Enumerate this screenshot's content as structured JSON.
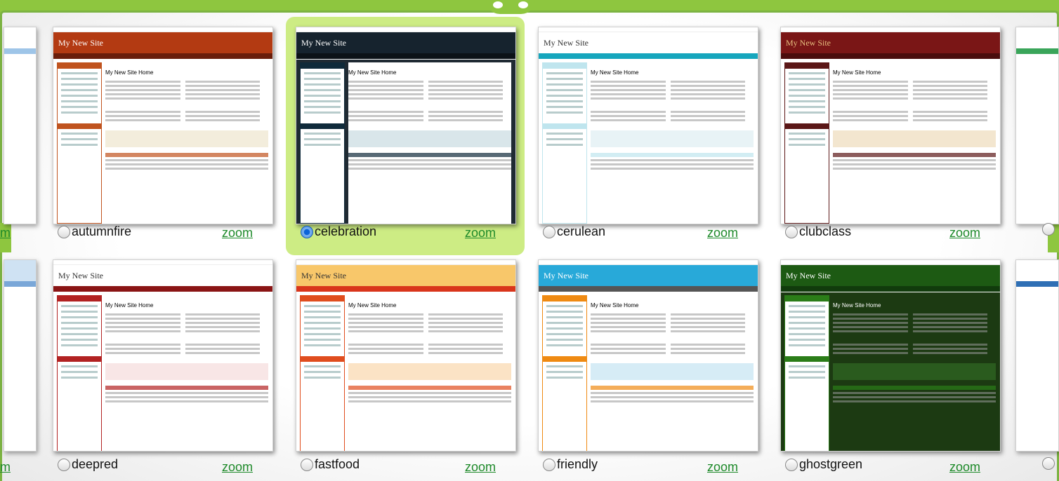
{
  "themes": [
    {
      "name": "autumnfire",
      "zoom": "zoom",
      "selected": false,
      "head": "#b33a12",
      "nav": "#6a1d0a",
      "accent": "#c0531e",
      "band": "#f3eddc",
      "site_color": "#ffffff"
    },
    {
      "name": "celebration",
      "zoom": "zoom",
      "selected": true,
      "head": "#16232e",
      "nav": "#0c1217",
      "accent": "#0f2a3a",
      "band": "#d9e6ea",
      "site_color": "#ffffff"
    },
    {
      "name": "cerulean",
      "zoom": "zoom",
      "selected": false,
      "head": "#ffffff",
      "nav": "#16a6bd",
      "accent": "#bfe5ee",
      "band": "#e8f3f6",
      "site_color": "#333333"
    },
    {
      "name": "clubclass",
      "zoom": "zoom",
      "selected": false,
      "head": "#7a1616",
      "nav": "#4a0c0c",
      "accent": "#5b1717",
      "band": "#f3e6cf",
      "site_color": "#e8c080"
    },
    {
      "name": "deepred",
      "zoom": "zoom",
      "selected": false,
      "head": "#ffffff",
      "nav": "#8a1414",
      "accent": "#b22222",
      "band": "#f8e6e6",
      "site_color": "#333333"
    },
    {
      "name": "fastfood",
      "zoom": "zoom",
      "selected": false,
      "head": "#f8c76a",
      "nav": "#d9351b",
      "accent": "#e04d1e",
      "band": "#fbe3c5",
      "site_color": "#333333"
    },
    {
      "name": "friendly",
      "zoom": "zoom",
      "selected": false,
      "head": "#28a9d9",
      "nav": "#555555",
      "accent": "#ef8a12",
      "band": "#d6ecf6",
      "site_color": "#ffffff"
    },
    {
      "name": "ghostgreen",
      "zoom": "zoom",
      "selected": false,
      "head": "#1d5a13",
      "nav": "#113b0c",
      "accent": "#2b7d18",
      "band": "#2a5b1e",
      "site_color": "#ffffff"
    }
  ],
  "thumb_text": {
    "site_title": "My New Site",
    "page_title": "My New Site Home"
  },
  "edge_labels": {
    "left_top": "m",
    "left_bottom": "m"
  }
}
